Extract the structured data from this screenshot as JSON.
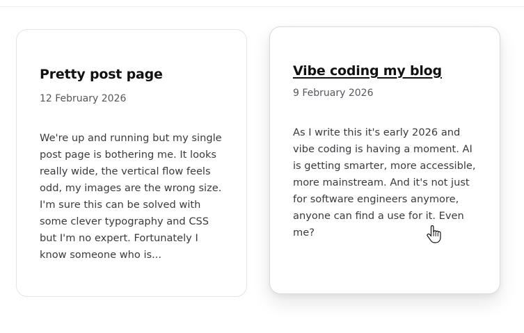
{
  "posts": [
    {
      "title": "Pretty post page",
      "date": "12 February 2026",
      "excerpt": "We're up and running but my single post page is bothering me. It looks really wide, the vertical flow feels odd, my images are the wrong size. I'm sure this can be solved with some clever typography and CSS but I'm no expert. Fortunately I know someone who is..."
    },
    {
      "title": "Vibe coding my blog",
      "date": "9 February 2026",
      "excerpt": "As I write this it's early 2026 and vibe coding is having a moment. AI is getting smarter, more accessible, more mainstream. And it's not just for software engineers anymore, anyone can find a use for it. Even me?"
    }
  ],
  "colors": {
    "card_border": "#e4e4e7",
    "title": "#111111",
    "date": "#55555c",
    "excerpt": "#3a3a3f"
  },
  "icons": {
    "cursor": "hand-pointer-icon"
  }
}
